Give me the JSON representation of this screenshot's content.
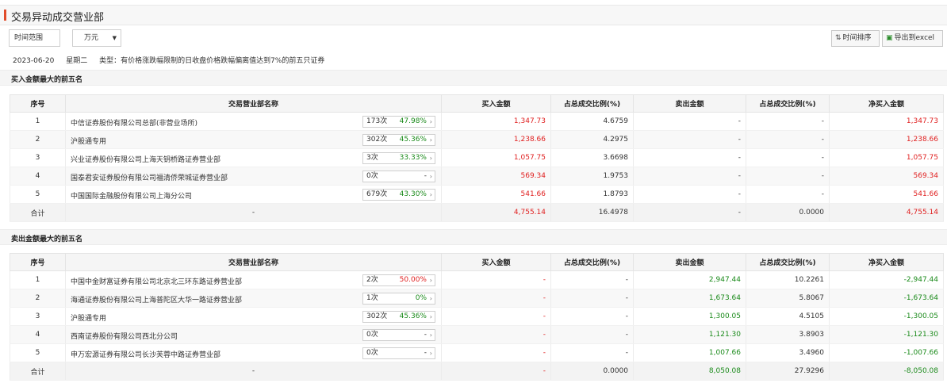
{
  "page": {
    "title": "交易异动成交营业部",
    "colors": {
      "accent": "#e14c2a",
      "up": "#e02020",
      "down": "#1a8a1a"
    }
  },
  "toolbar": {
    "range_label": "时间范围",
    "unit_value": "万元",
    "sort_label": "时间排序",
    "sort_icon": "sort-arrows-icon",
    "export_label": "导出到excel",
    "export_icon": "excel-icon"
  },
  "info": {
    "date": "2023-06-20",
    "weekday": "星期二",
    "type": "类型：有价格涨跌幅限制的日收盘价格跌幅偏离值达到7%的前五只证券"
  },
  "columns": [
    "序号",
    "交易营业部名称",
    "买入金额",
    "占总成交比例(%)",
    "卖出金额",
    "占总成交比例(%)",
    "净买入金额"
  ],
  "buy": {
    "heading": "买入金额最大的前五名",
    "rows": [
      {
        "no": "1",
        "name": "中信证券股份有限公司总部(非营业场所)",
        "count": "173次",
        "pct": "47.98%",
        "buy": "1,347.73",
        "buy_ratio": "4.6759",
        "sell": "-",
        "sell_ratio": "-",
        "net": "1,347.73"
      },
      {
        "no": "2",
        "name": "沪股通专用",
        "count": "302次",
        "pct": "45.36%",
        "buy": "1,238.66",
        "buy_ratio": "4.2975",
        "sell": "-",
        "sell_ratio": "-",
        "net": "1,238.66"
      },
      {
        "no": "3",
        "name": "兴业证券股份有限公司上海天钥桥路证券营业部",
        "count": "3次",
        "pct": "33.33%",
        "buy": "1,057.75",
        "buy_ratio": "3.6698",
        "sell": "-",
        "sell_ratio": "-",
        "net": "1,057.75"
      },
      {
        "no": "4",
        "name": "国泰君安证券股份有限公司福清侨荣城证券营业部",
        "count": "0次",
        "pct": "-",
        "buy": "569.34",
        "buy_ratio": "1.9753",
        "sell": "-",
        "sell_ratio": "-",
        "net": "569.34"
      },
      {
        "no": "5",
        "name": "中国国际金融股份有限公司上海分公司",
        "count": "679次",
        "pct": "43.30%",
        "buy": "541.66",
        "buy_ratio": "1.8793",
        "sell": "-",
        "sell_ratio": "-",
        "net": "541.66"
      }
    ],
    "total": {
      "label": "合计",
      "name": "-",
      "buy": "4,755.14",
      "buy_ratio": "16.4978",
      "sell": "-",
      "sell_ratio": "0.0000",
      "net": "4,755.14"
    }
  },
  "sell": {
    "heading": "卖出金额最大的前五名",
    "rows": [
      {
        "no": "1",
        "name": "中国中金财富证券有限公司北京北三环东路证券营业部",
        "count": "2次",
        "pct": "50.00%",
        "buy": "-",
        "buy_ratio": "-",
        "sell": "2,947.44",
        "sell_ratio": "10.2261",
        "net": "-2,947.44"
      },
      {
        "no": "2",
        "name": "海通证券股份有限公司上海普陀区大华一路证券营业部",
        "count": "1次",
        "pct": "0%",
        "buy": "-",
        "buy_ratio": "-",
        "sell": "1,673.64",
        "sell_ratio": "5.8067",
        "net": "-1,673.64"
      },
      {
        "no": "3",
        "name": "沪股通专用",
        "count": "302次",
        "pct": "45.36%",
        "buy": "-",
        "buy_ratio": "-",
        "sell": "1,300.05",
        "sell_ratio": "4.5105",
        "net": "-1,300.05"
      },
      {
        "no": "4",
        "name": "西南证券股份有限公司西北分公司",
        "count": "0次",
        "pct": "-",
        "buy": "-",
        "buy_ratio": "-",
        "sell": "1,121.30",
        "sell_ratio": "3.8903",
        "net": "-1,121.30"
      },
      {
        "no": "5",
        "name": "申万宏源证券有限公司长沙芙蓉中路证券营业部",
        "count": "0次",
        "pct": "-",
        "buy": "-",
        "buy_ratio": "-",
        "sell": "1,007.66",
        "sell_ratio": "3.4960",
        "net": "-1,007.66"
      }
    ],
    "total": {
      "label": "合计",
      "name": "-",
      "buy": "-",
      "buy_ratio": "0.0000",
      "sell": "8,050.08",
      "sell_ratio": "27.9296",
      "net": "-8,050.08"
    }
  }
}
